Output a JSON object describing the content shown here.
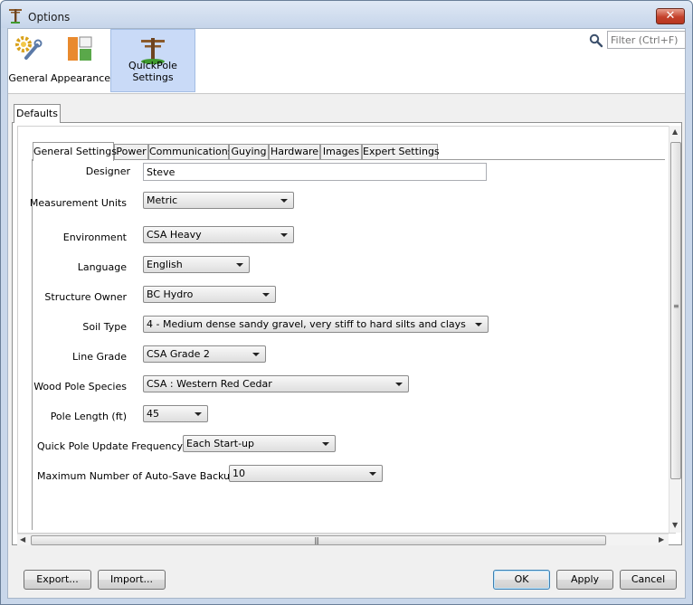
{
  "window": {
    "title": "Options",
    "close_label": "✕"
  },
  "categories": [
    {
      "label": "General",
      "icon": "gear-wrench-icon"
    },
    {
      "label": "Appearance",
      "icon": "appearance-icon"
    },
    {
      "label": "QuickPole Settings",
      "icon": "pole-icon",
      "selected": true
    }
  ],
  "filter": {
    "placeholder": "Filter (Ctrl+F)"
  },
  "outer_tab": "Defaults",
  "tabs": [
    "General Settings",
    "Power",
    "Communications",
    "Guying",
    "Hardware",
    "Images",
    "Expert Settings"
  ],
  "active_tab": "General Settings",
  "fields": {
    "designer": {
      "label": "Designer",
      "value": "Steve"
    },
    "measurement_units": {
      "label": "Measurement Units",
      "value": "Metric"
    },
    "environment": {
      "label": "Environment",
      "value": "CSA Heavy"
    },
    "language": {
      "label": "Language",
      "value": "English"
    },
    "structure_owner": {
      "label": "Structure Owner",
      "value": "BC Hydro"
    },
    "soil_type": {
      "label": "Soil Type",
      "value": "4 - Medium dense sandy gravel, very stiff to hard silts and clays"
    },
    "line_grade": {
      "label": "Line Grade",
      "value": "CSA Grade 2"
    },
    "wood_pole_species": {
      "label": "Wood Pole Species",
      "value": "CSA : Western Red Cedar"
    },
    "pole_length": {
      "label": "Pole Length (ft)",
      "value": "45"
    },
    "update_frequency": {
      "label": "Quick Pole Update Frequency",
      "value": "Each Start-up"
    },
    "autosave_backups": {
      "label": "Maximum Number of Auto-Save Backups",
      "value": "10"
    }
  },
  "buttons": {
    "export": "Export...",
    "import": "Import...",
    "ok": "OK",
    "apply": "Apply",
    "cancel": "Cancel"
  },
  "scrollbars": {
    "up": "▲",
    "down": "▼",
    "left": "◀",
    "right": "▶",
    "grip_v": "≡",
    "grip_h": "|||"
  },
  "colors": {
    "selection": "#c9daf7",
    "title_bar": "#c6d5ea",
    "close_button": "#c4412b",
    "default_button_border": "#3c7fb1"
  }
}
